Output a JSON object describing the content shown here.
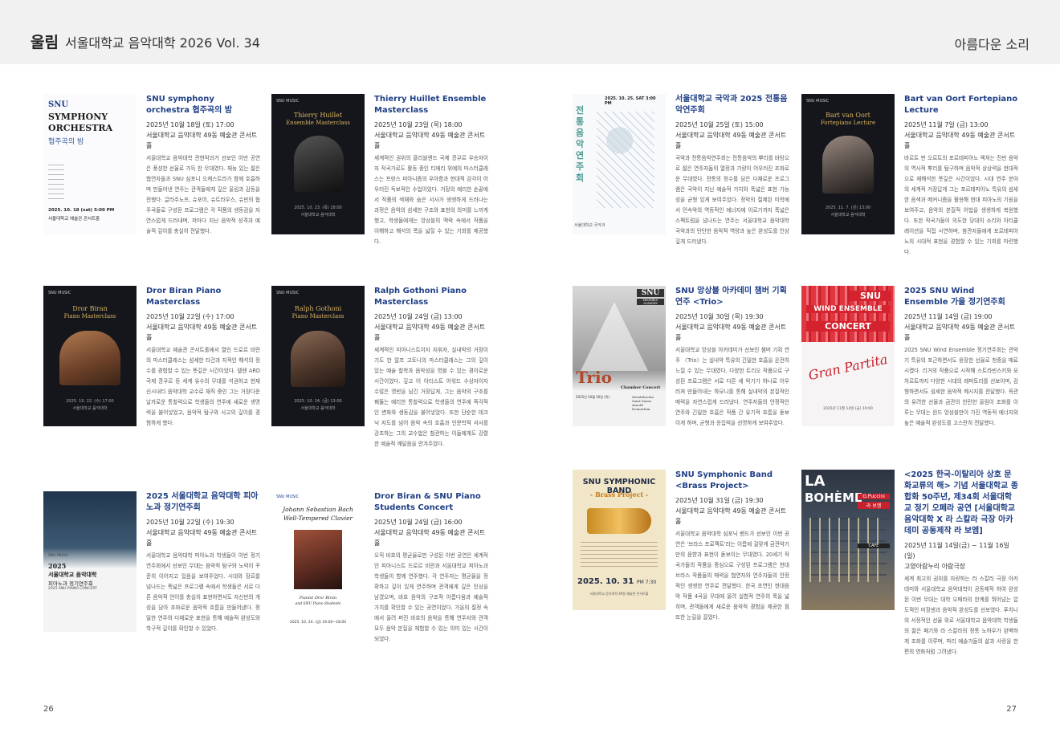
{
  "header": {
    "brand": "울림",
    "title": "서울대학교 음악대학 2026 Vol. 34",
    "section": "아름다운 소리"
  },
  "pages": {
    "left": "26",
    "right": "27"
  },
  "cards": [
    {
      "title": "SNU symphony orchestra 협주곡의 밤",
      "date": "2025년 10월 18일 (토) 17:00",
      "venue": "서울대학교 음악대학 49동 예술관 콘서트홀",
      "desc": "서울대학교 음악대학 관현악과가 선보인 이번 공연은 풍성한 선율로 가득 찬 무대였다. 재능 있는 젊은 협연자들과 SNU 심포니 오케스트라가 함께 호흡하며 만들어낸 연주는 관객들에게 깊은 울림과 감동을 전했다. 글라주노프, 슈포어, 슈트라우스, 슈만의 협주곡들로 구성된 프로그램은 각 작품의 생동감을 자연스럽게 드러내며, 저마다 지닌 음악적 성격과 예술적 깊이를 충실히 전달했다.",
      "poster": {
        "l1": "SNU",
        "l2": "SYMPHONY",
        "l3": "ORCHESTRA",
        "l4": "협주곡의 밤",
        "l5": "2025. 10. 18 (sat) 5:00 PM",
        "l6": "서울대학교 예술관 콘서트홀"
      }
    },
    {
      "title": "Thierry Huillet Ensemble Masterclass",
      "date": "2025년 10월 23일 (목) 18:00",
      "venue": "서울대학교 음악대학 49동 예술관 콘서트홀",
      "desc": "세계적인 권위의 클리블랜드 국제 콩쿠르 우승자이자 작곡가로도 활동 중인 티에리 위예의 마스터클래스는 프랑스 피아니즘의 우아함과 현대적 감각이 어우러진 독보적인 수업이었다. 거장의 예리한 손끝에서 작품의 색채와 숨은 서사가 생생하게 드러나는 과정은 음악의 섬세한 구조와 표현의 의미를 느끼게 했고, 학생들에게는 앙상블의 맥락 속에서 작품을 이해하고 해석의 폭을 넓힐 수 있는 기회를 제공했다.",
      "poster": {
        "l1": "SNU MUSIC",
        "l2": "Thierry Huillet",
        "l3": "Ensemble Masterclass",
        "l4": "2025. 10. 23. (목) 18:00",
        "l5": "서울대학교 음악대학"
      }
    },
    {
      "title": "Dror Biran Piano Masterclass",
      "date": "2025년 10월 22일 (수) 17:00",
      "venue": "서울대학교 음악대학 49동 예술관 콘서트홀",
      "desc": "서울대학교 예술관 콘서트홀에서 열린 드로르 비란의 마스터클래스는 섬세한 타건과 지적인 해석의 정수를 경험할 수 있는 뜻깊은 시간이었다. 텔렌 ARD 국제 콩쿠르 등 세계 유수의 무대를 석권하고 현재 신시내티 음악대학 교수로 재직 중인 그는 거장다운 날카로운 통찰력으로 학생들의 연주에 새로운 생명력을 불어넣었고, 음악적 탐구와 사고의 깊이를 경험하게 했다.",
      "poster": {
        "l1": "SNU MUSIC",
        "l2": "Dror Biran",
        "l3": "Piano Masterclass",
        "l4": "2025. 10. 22. (수) 17:00",
        "l5": "서울대학교 음악대학"
      }
    },
    {
      "title": "Ralph Gothoni Piano Masterclass",
      "date": "2025년 10월 24일 (금) 13:00",
      "venue": "서울대학교 음악대학 49동 예술관 콘서트홀",
      "desc": "세계적인 피아니스트이자 지휘자, 실내악의 거장이기도 한 랄프 고토니의 마스터클래스는 그의 깊이 있는 예술 철학과 음악성을 엿볼 수 있는 경이로운 시간이었다. 깊고 어 아티스트 어워드 수상자이자 수많은 명반을 남긴 거장답게, 그는 음악의 구조를 꿰뚫는 예리한 통찰력으로 학생들의 연주에 즉각적인 변화와 생동감을 불어넣었다. 또한 단순한 테크닉 지도를 넘어 음악 속의 호흡과 인문학적 서사를 강조하는 그의 교수법은 참관하는 이들에게도 강렬한 예술적 깨달음을 안겨주었다.",
      "poster": {
        "l1": "SNU MUSIC",
        "l2": "Ralph Gothoni",
        "l3": "Piano Masterclass",
        "l4": "2025. 10. 24. (금) 13:00",
        "l5": "서울대학교 음악대학"
      }
    },
    {
      "title": "2025 서울대학교 음악대학 피아노과 정기연주회",
      "date": "2025년 10월 22일 (수) 19:30",
      "venue": "서울대학교 음악대학 49동 예술관 콘서트홀",
      "desc": "서울대학교 음악대학 피아노과 학생들이 이번 정기연주회에서 선보인 무대는 음악적 탐구와 노력이 꾸준히 이어지고 있음을 보여주었다. 시대와 장르를 넘나드는 폭넓은 프로그램 속에서 학생들은 서로 다른 음악적 언어를 충실히 표현하면서도 자신만의 개성을 담아 조화로운 음악적 흐름을 만들어냈다. 정밀한 연주와 다채로운 표현을 통해 예술적 완성도와 학구적 깊이를 확인할 수 있었다.",
      "poster": {
        "l1": "SNU MUSIC",
        "l2": "2025",
        "l3": "서울대학교 음악대학",
        "l4": "피아노과 정기연주회",
        "l5": "2025 SNU PIANO CONCERT"
      }
    },
    {
      "title": "Dror Biran & SNU Piano Students Concert",
      "date": "2025년 10월 24일 (금) 16:00",
      "venue": "서울대학교 음악대학 49동 예술관 콘서트홀",
      "desc": "오직 바흐의 평균율로만 구성된 이번 공연은 세계적인 피아니스트 드로르 비란과 서울대학교 피아노과 학생들이 함께 연주했다. 각 연주자는 평균율을 정확하고 깊이 있게 연주하며 관객에게 깊은 인상을 남겼으며, 바흐 음악의 구조적 아름다움과 예술적 가치를 확인할 수 있는 공연이었다. 가을의 절정 속에서 울려 퍼진 바흐의 음악을 통해 연주자와 관객 모두 음악 본질을 체험할 수 있는 의미 있는 시간이 되었다.",
      "poster": {
        "l1": "SNU MUSIC",
        "l2": "Johann Sebastian Bach",
        "l3": "Well-Tempered Clavier",
        "l4": "Pianist Dror Biran",
        "l5": "and SNU Piano Students",
        "l6": "2025. 10. 24. (금) 16:00~18:00"
      }
    },
    {
      "title": "서울대학교 국악과 2025 전통음악연주회",
      "date": "2025년 10월 25일 (토) 15:00",
      "venue": "서울대학교 음악대학 49동 예술관 콘서트홀",
      "desc": "국악과 전통음악연주회는 전통음악의 뿌리를 바탕으로 젊은 연주자들의 열정과 기량이 어우러진 조화로운 무대였다. 전통의 정수를 담은 다채로운 프로그램은 국악이 지닌 예술적 가치와 폭넓은 표현 가능성을 균형 있게 보여주었다. 정악의 절제된 미학에서 민속악의 역동적인 에너지에 이르기까지 폭넓은 스펙트럼을 넘나드는 연주는 서울대학교 음악대학 국악과의 탄탄한 음악적 역량과 높은 완성도를 인상 깊게 드러냈다.",
      "poster": {
        "l1": "2025. 10. 25. SAT 3:00 PM",
        "l2": "전통음악연주회",
        "l3": "서울대학교 국악과"
      }
    },
    {
      "title": "Bart van Oort Fortepiano Lecture",
      "date": "2025년 11월 7일 (금) 13:00",
      "venue": "서울대학교 음악대학 49동 예술관 콘서트홀",
      "desc": "바르트 판 오르트의 포르테피아노 렉처는 진반 음악의 역사적 뿌리를 탐구하며 음악적 상상력을 현대적으로 재해석한 뜻깊은 시간이었다. 시대 연주 분야의 세계적 거장답게 그는 포르테피아노 특유의 섬세한 음색과 메커니즘을 활용해 현대 피아노의 기원을 보여주고, 음악의 본질적 어법을 생생하게 복원했다. 또한 작곡가들이 의도한 당대의 소리와 아티큘레이션을 직접 시연하며, 참관자들에게 포르테피아노의 시대적 표현을 경험할 수 있는 기회를 마련했다.",
      "poster": {
        "l1": "SNU MUSIC",
        "l2": "Bart van Oort",
        "l3": "Fortepiano Lecture",
        "l4": "2025. 11. 7. (금) 13:00",
        "l5": "서울대학교 음악대학"
      }
    },
    {
      "title": "SNU 앙상블 아카데미 챔버 기획 연주 <Trio>",
      "date": "2025년 10월 30일 (목) 19:30",
      "venue": "서울대학교 음악대학 49동 예술관 콘서트홀",
      "desc": "서울대학교 앙상블 아카데미가 선보인 챔버 기획 연주 〈Trio〉는 실내악 특유의 긴밀한 호흡을 온전히 느낄 수 있는 무대였다. 다양한 트리오 작품으로 구성된 프로그램은 서로 다른 세 악기가 하나로 어우러져 만들어내는 하모니를 통해 실내악의 본질적인 매력을 자연스럽게 드러냈다. 연주자들의 안정적인 연주와 긴밀한 호흡은 작품 간 유기적 흐름을 돋보이게 하며, 균형과 응집력을 선명하게 보여주었다.",
      "poster": {
        "l1": "SNU",
        "l2": "ENSEMBLE ACADEMY",
        "l3": "Trio",
        "l4": "Chamber Concert",
        "l5": "2025년 10월 30일 (목)",
        "l6": "Mendelssohn Saint-Saens Arnold Dennerlein"
      }
    },
    {
      "title": "2025 SNU Wind Ensemble 가을 정기연주회",
      "date": "2025년 11월 14일 (금) 19:00",
      "venue": "서울대학교 음악대학 49동 예술관 콘서트홀",
      "desc": "2025 SNU Wind Ensemble 정기연주회는 관악기 특유의 포근하면서도 웅장한 선율로 청중을 매료시켰다. 리거의 작품으로 시작해 스트라빈스키와 모차르트까지 다양한 시대의 레퍼토리를 선보이며, 감형하면서도 섬세한 음악적 메시지를 전달했다. 목관의 유려한 선율과 금관의 찬란한 울림이 조화를 이루는 무대는 윈드 앙상블만이 가진 역동적 에너지와 높은 예술적 완성도를 고스란히 전달했다.",
      "poster": {
        "l1": "SNU",
        "l2": "WIND ENSEMBLE",
        "l3": "CONCERT",
        "l4": "Gran Partita",
        "l5": "2025년 11월 14일 (금) 19:00"
      }
    },
    {
      "title": "SNU Symphonic Band <Brass Project>",
      "date": "2025년 10월 31일 (금) 19:30",
      "venue": "서울대학교 음악대학 49동 예술관 콘서트홀",
      "desc": "서울대학교 음악대학 심포닉 밴드가 선보인 이번 공연은 '브라스 프로젝트'라는 이름에 걸맞게 금관악기만의 음향과 표현이 돋보이는 무대였다. 20세기 작곡가들의 작품을 중심으로 구성된 프로그램은 현대 브라스 작품들의 매력을 협연자와 연주자들의 안정적인 생생한 연주로 전달했다. 한국 초연인 현대음악 작품 4곡을 무대에 올려 실험적 연주의 폭을 넓히며, 관객들에게 새로운 음악적 경험을 제공한 점 또한 눈길을 끌었다.",
      "poster": {
        "l1": "SNU SYMPHONIC BAND",
        "l2": "- Brass Project -",
        "l3": "2025. 10. 31",
        "l4": "PM 7:30",
        "l5": "서울대학교 음악대학 49동 예술관 콘서트홀"
      }
    },
    {
      "title": "<2025 한국-이탈리아 상호 문화교류의 해> 기념 서울대학교 종합화 50주년, 제34회 서울대학교 정기 오페라 공연 [서울대학교 음악대학 X 라 스칼라 극장 아카데미 공동제작 라 보엠]",
      "date": "2025년 11월 14일(금) ~ 11월 16일(일)",
      "venue": "고양아람누리 아람극장",
      "desc": "세계 최고의 권위를 자랑하는 라 스칼라 극장 아카데미와 서울대학교 음악대학이 공동제작 하여 완성된 이번 무대는 대학 오페라의 한계를 뛰어넘는 압도적인 미장센과 음악적 완성도를 선보였다. 푸치니의 서정적인 선율 위로 서울대학교 음악대학 학생들의 젊은 패기와 라 스칼라의 정통 노하우가 완벽하게 조화를 이루며, 파리 예술가들의 삶과 사랑을 한 편의 영화처럼 그려냈다.",
      "poster": {
        "l1": "LA",
        "l2": "BOHÈME",
        "l3": "G.Puccini",
        "l4": "라 보엠",
        "l5": "CAFÉ"
      }
    }
  ]
}
